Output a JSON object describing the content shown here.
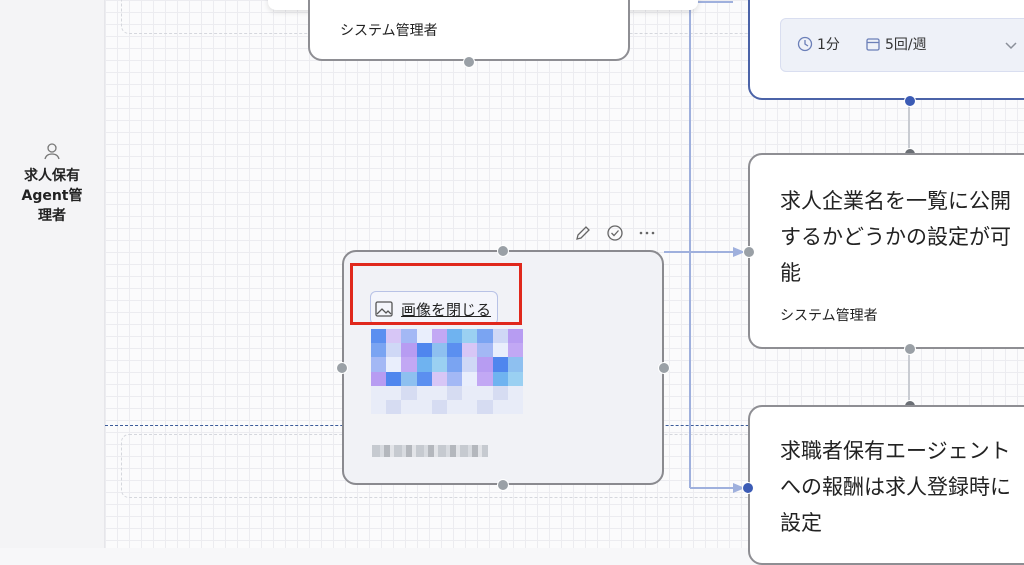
{
  "lane": {
    "label": "求人保有Agent管理者"
  },
  "cards": {
    "top_left": {
      "role": "システム管理者"
    },
    "top_right": {
      "duration": "1分",
      "frequency": "5回/週"
    },
    "middle_right": {
      "title": "求人企業名を一覧に公開するかどうかの設定が可能",
      "role": "システム管理者"
    },
    "bottom_right": {
      "title": "求職者保有エージェントへの報酬は求人登録時に設定"
    },
    "selected": {
      "toggle_label": "画像を閉じる",
      "toolbar": [
        "edit-icon",
        "check-icon",
        "more-icon"
      ]
    }
  },
  "colors": {
    "accent_blue": "#4b63a8",
    "highlight_red": "#e0281c"
  }
}
